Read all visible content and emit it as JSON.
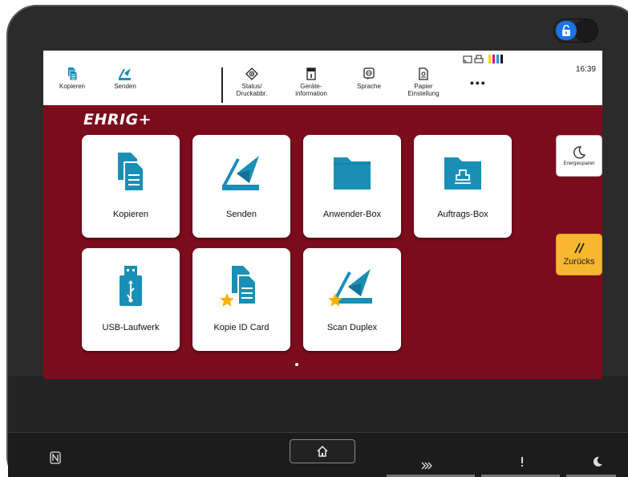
{
  "topbar": {
    "items": [
      {
        "label": "Kopieren",
        "icon": "copy-icon"
      },
      {
        "label": "Senden",
        "icon": "send-icon"
      },
      {
        "label": "Status/\nDruckabbr.",
        "icon": "status-icon"
      },
      {
        "label": "Geräte-\ninformation",
        "icon": "device-info-icon"
      },
      {
        "label": "Sprache",
        "icon": "language-icon"
      },
      {
        "label": "Papier\nEinstellung",
        "icon": "paper-settings-icon"
      }
    ],
    "more": "•••",
    "clock": "16:39",
    "ink_colors": [
      "#f5d800",
      "#e0007a",
      "#00a0e0",
      "#111111"
    ]
  },
  "brand": "EHRIG+",
  "tiles": [
    {
      "label": "Kopieren",
      "icon": "copy-icon"
    },
    {
      "label": "Senden",
      "icon": "send-icon"
    },
    {
      "label": "Anwender-Box",
      "icon": "folder-icon"
    },
    {
      "label": "Auftrags-Box",
      "icon": "job-box-icon"
    },
    {
      "label": "USB-Laufwerk",
      "icon": "usb-icon"
    },
    {
      "label": "Kopie ID Card",
      "icon": "id-copy-icon"
    },
    {
      "label": "Scan Duplex",
      "icon": "scan-duplex-icon"
    }
  ],
  "side": {
    "energy_label": "Energiesparen",
    "back_label": "Zurücks"
  },
  "colors": {
    "accent": "#1a8fb5",
    "background": "#7a0c1c",
    "star": "#f5b300",
    "back_button": "#f7b731"
  }
}
